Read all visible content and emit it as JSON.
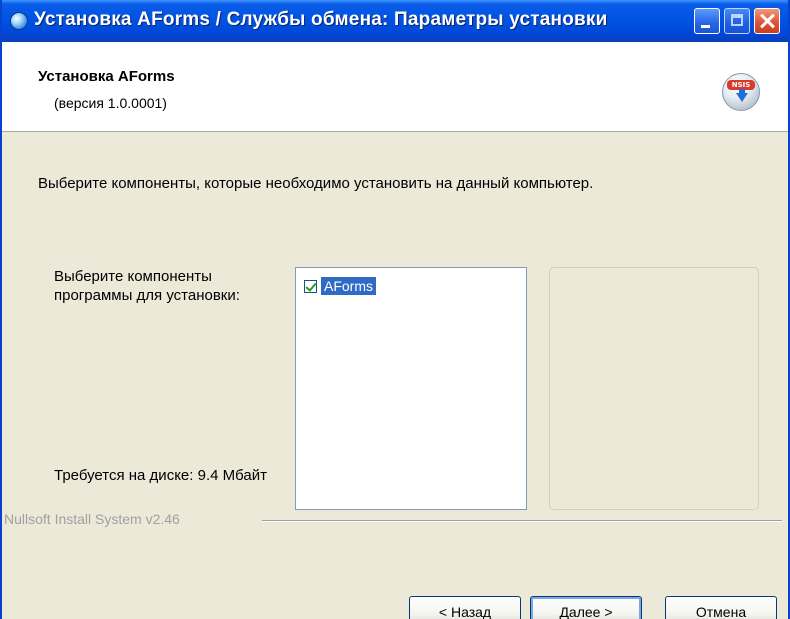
{
  "window": {
    "title": "Установка AForms / Службы обмена: Параметры установки"
  },
  "header": {
    "title": "Установка AForms",
    "version": "(версия 1.0.0001)",
    "icon_badge": "NSIS"
  },
  "body": {
    "intro": "Выберите компоненты, которые необходимо установить на данный компьютер.",
    "select_label": "Выберите компоненты программы для установки:",
    "disk_label": "Требуется на диске: 9.4 Мбайт",
    "components": [
      {
        "label": "AForms",
        "checked": true,
        "selected": true
      }
    ]
  },
  "footer": {
    "branding": "Nullsoft Install System v2.46",
    "back_label": "< Назад",
    "next_label": "Далее >",
    "cancel_label": "Отмена"
  },
  "colors": {
    "titlebar": "#0054e3",
    "dialog_bg": "#ece9d8",
    "selection": "#316ac5",
    "close_button": "#e0553a"
  },
  "icons": {
    "app": "installer-globe-icon",
    "header": "nsis-install-icon",
    "minimize": "minimize-icon",
    "maximize": "maximize-icon",
    "close": "close-icon"
  }
}
